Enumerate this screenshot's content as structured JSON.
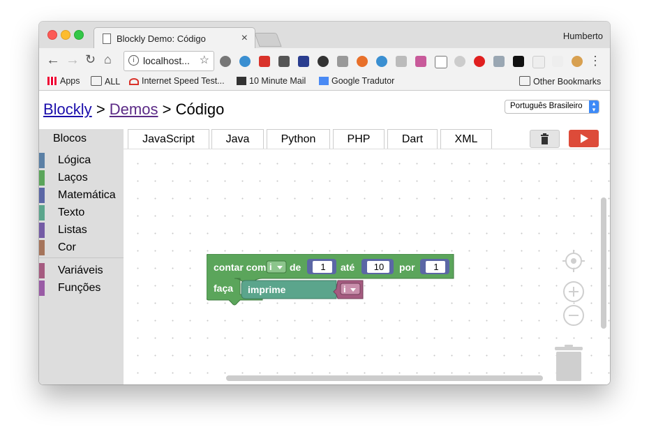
{
  "browser": {
    "tab_title": "Blockly Demo: Código",
    "tab_close": "×",
    "profile": "Humberto",
    "url": "localhost...",
    "bookmarks": [
      "Apps",
      "ALL",
      "Internet Speed Test...",
      "10 Minute Mail",
      "Google Tradutor"
    ],
    "other_bookmarks": "Other Bookmarks"
  },
  "page": {
    "breadcrumb": {
      "blockly": "Blockly",
      "sep1": ">",
      "demos": "Demos",
      "sep2": ">",
      "current": "Código"
    },
    "language_select": "Português Brasileiro"
  },
  "sidebar": {
    "title": "Blocos",
    "items": [
      {
        "label": "Lógica",
        "color": "#5b80a5"
      },
      {
        "label": "Laços",
        "color": "#5ba55b"
      },
      {
        "label": "Matemática",
        "color": "#5b67a5"
      },
      {
        "label": "Texto",
        "color": "#5ba58c"
      },
      {
        "label": "Listas",
        "color": "#745ba5"
      },
      {
        "label": "Cor",
        "color": "#a5745b"
      },
      {
        "label": "Variáveis",
        "color": "#a55b80"
      },
      {
        "label": "Funções",
        "color": "#995ba5"
      }
    ]
  },
  "code_tabs": [
    "JavaScript",
    "Java",
    "Python",
    "PHP",
    "Dart",
    "XML"
  ],
  "blocks": {
    "count_with": "contar com",
    "var": "i",
    "from": "de",
    "from_value": "1",
    "to": "até",
    "to_value": "10",
    "by": "por",
    "by_value": "1",
    "do": "faça",
    "print": "imprime",
    "print_var": "i"
  },
  "colors": {
    "loop_block": "#5ba55b",
    "text_block": "#5ba58c",
    "variable_block": "#a55b80",
    "run": "#dd4b39"
  }
}
